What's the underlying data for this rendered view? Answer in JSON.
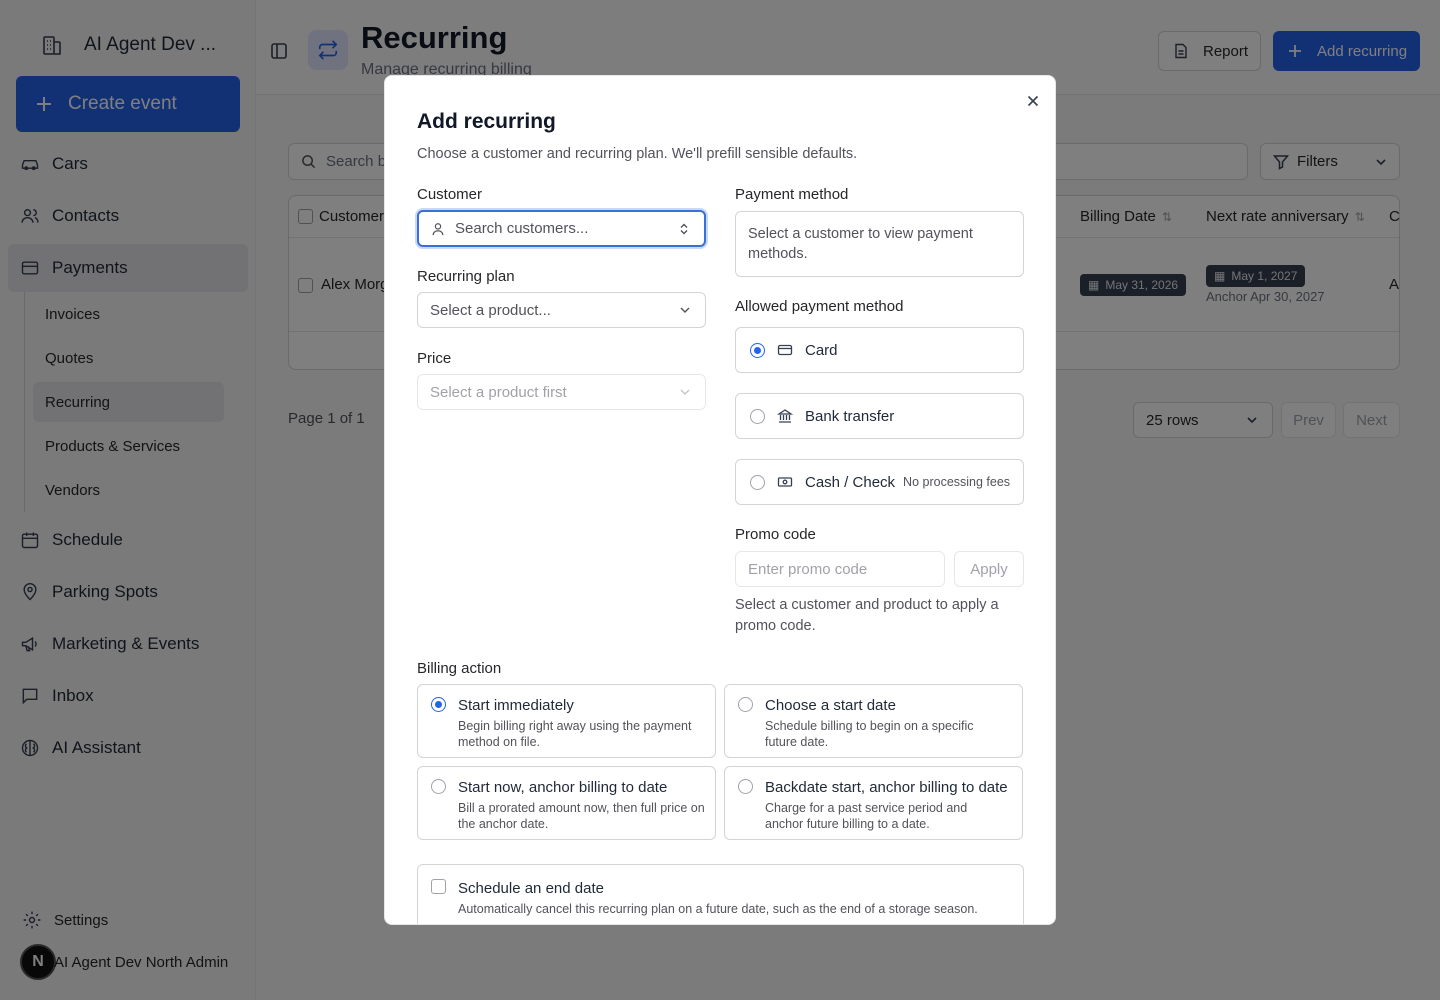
{
  "sidebar": {
    "brand": "AI Agent Dev ...",
    "create_event": "Create event",
    "items": {
      "cars": "Cars",
      "contacts": "Contacts",
      "payments": "Payments",
      "schedule": "Schedule",
      "parking": "Parking Spots",
      "marketing": "Marketing & Events",
      "inbox": "Inbox",
      "assistant": "AI Assistant"
    },
    "payments_sub": {
      "invoices": "Invoices",
      "quotes": "Quotes",
      "recurring": "Recurring",
      "products": "Products & Services",
      "vendors": "Vendors"
    },
    "settings": "Settings",
    "user_initial": "N",
    "user_name": "AI Agent Dev North Admin"
  },
  "header": {
    "title": "Recurring",
    "subtitle": "Manage recurring billing",
    "report": "Report",
    "add_recurring": "Add recurring"
  },
  "toolbar": {
    "search_placeholder": "Search by",
    "filters": "Filters"
  },
  "table": {
    "columns": {
      "customer": "Customer",
      "billing_date": "Billing Date",
      "next_rate": "Next rate anniversary",
      "last_col": "C"
    },
    "rows": [
      {
        "customer": "Alex Morg",
        "billing_date": "May 31, 2026",
        "next_rate": "May 1, 2027",
        "anchor": "Anchor Apr 30, 2027",
        "last_col": "A"
      }
    ]
  },
  "pagination": {
    "page_info": "Page 1 of 1",
    "rows": "25 rows",
    "prev": "Prev",
    "next": "Next"
  },
  "modal": {
    "title": "Add recurring",
    "description": "Choose a customer and recurring plan. We'll prefill sensible defaults.",
    "customer_label": "Customer",
    "customer_placeholder": "Search customers...",
    "plan_label": "Recurring plan",
    "plan_placeholder": "Select a product...",
    "price_label": "Price",
    "price_placeholder": "Select a product first",
    "payment_method_label": "Payment method",
    "payment_method_text": "Select a customer to view payment methods.",
    "allowed_label": "Allowed payment method",
    "options": {
      "card": "Card",
      "bank": "Bank transfer",
      "cash": "Cash / Check",
      "cash_note": "No processing fees"
    },
    "promo_label": "Promo code",
    "promo_placeholder": "Enter promo code",
    "apply": "Apply",
    "promo_help": "Select a customer and product to apply a promo code.",
    "billing_label": "Billing action",
    "billing": {
      "immediate_title": "Start immediately",
      "immediate_desc": "Begin billing right away using the payment method on file.",
      "choose_title": "Choose a start date",
      "choose_desc": "Schedule billing to begin on a specific future date.",
      "anchor_title": "Start now, anchor billing to date",
      "anchor_desc": "Bill a prorated amount now, then full price on the anchor date.",
      "backdate_title": "Backdate start, anchor billing to date",
      "backdate_desc": "Charge for a past service period and anchor future billing to a date."
    },
    "end_title": "Schedule an end date",
    "end_desc": "Automatically cancel this recurring plan on a future date, such as the end of a storage season."
  },
  "colors": {
    "accent": "#2563eb",
    "overlay": "rgba(0,0,0,0.5)"
  }
}
